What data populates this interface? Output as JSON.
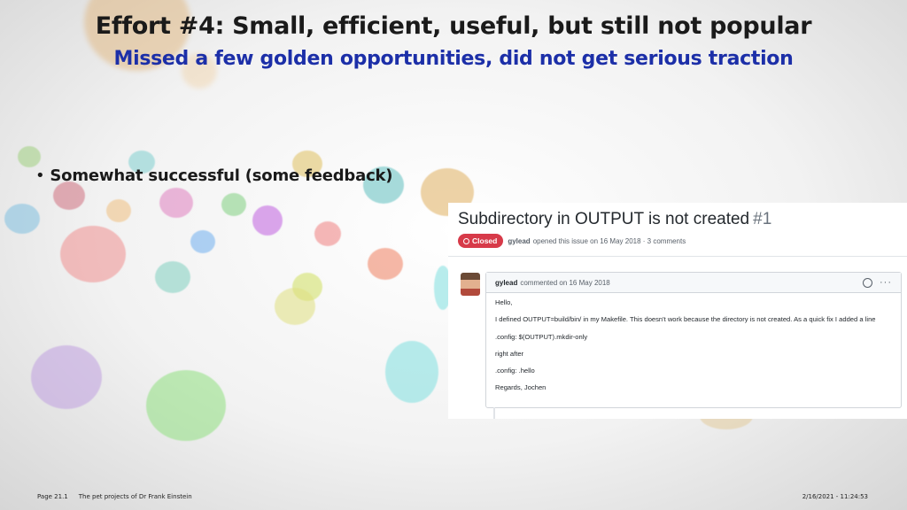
{
  "slide": {
    "title": "Effort #4: Small, efficient, useful, but still not popular",
    "subtitle": "Missed a few golden opportunities, did not get serious traction",
    "bullets": [
      "Somewhat successful (some feedback)"
    ],
    "colors": {
      "title": "#1a1a1a",
      "subtitle": "#1c2fa8"
    }
  },
  "issue": {
    "title": "Subdirectory in OUTPUT is not created",
    "number": "#1",
    "state": "Closed",
    "author": "gylead",
    "meta": "opened this issue on 16 May 2018 · 3 comments",
    "colors": {
      "closed_badge": "#d73a49"
    },
    "comment": {
      "author": "gylead",
      "meta": "commented on 16 May 2018",
      "more": "···",
      "lines": [
        "Hello,",
        "I defined OUTPUT=build/bin/ in my Makefile. This doesn't work because the directory is not created. As a quick fix I added a line",
        ".config: $(OUTPUT).mkdir-only",
        "right after",
        ".config: .hello",
        "Regards, Jochen"
      ]
    }
  },
  "footer": {
    "page": "Page 21.1",
    "talk": "The pet projects of Dr Frank Einstein",
    "datetime": "2/16/2021 - 11:24:53"
  }
}
